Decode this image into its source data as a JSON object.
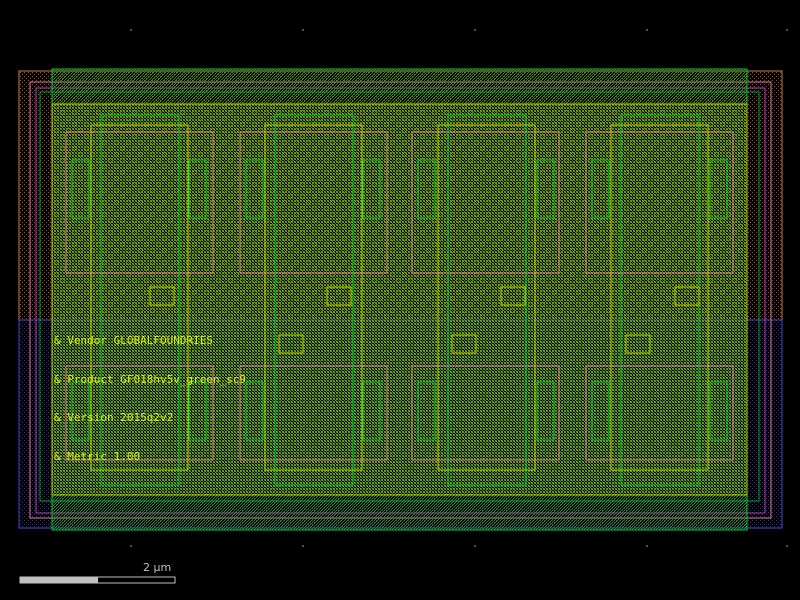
{
  "layout_texts": [
    "& Vendor GLOBALFOUNDRIES",
    "& Product GF018hv5v_green_sc9",
    "& Version 2015q2v2",
    "& Metric 1.00"
  ],
  "scale_bar": {
    "label": "2 µm"
  },
  "colors": {
    "background": "#000000",
    "layer_green": "#00cc33",
    "layer_yellow": "#c0d000",
    "layer_pink": "#e67899",
    "layer_orange": "#d08040",
    "layer_blue": "#4a4ad0",
    "layer_magenta": "#b040c0",
    "text_yellow": "#e0ee20",
    "scale_bar": "#c0c0c0",
    "grid_dot": "#505050"
  }
}
